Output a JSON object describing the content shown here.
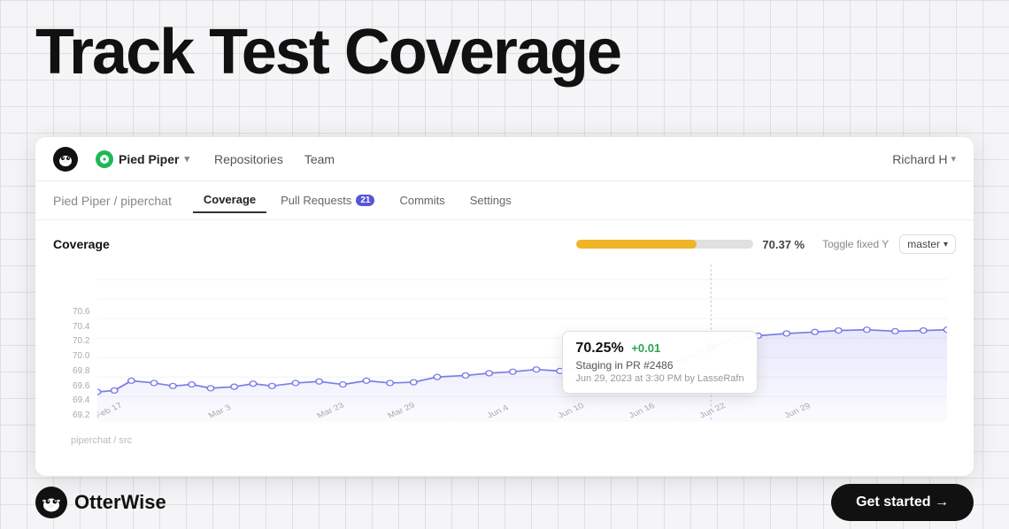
{
  "page": {
    "headline": "Track Test Coverage",
    "background_color": "#f5f5f7"
  },
  "nav": {
    "logo_alt": "OtterWise logo",
    "brand_name": "Pied Piper",
    "brand_chevron": "▾",
    "links": [
      {
        "label": "Repositories",
        "id": "repositories"
      },
      {
        "label": "Team",
        "id": "team"
      }
    ],
    "user": "Richard H",
    "user_chevron": "▾"
  },
  "breadcrumb": {
    "org": "Pied Piper",
    "separator": " / ",
    "repo": "piperchat"
  },
  "tabs": [
    {
      "label": "Coverage",
      "id": "coverage",
      "active": true,
      "badge": null
    },
    {
      "label": "Pull Requests",
      "id": "pull-requests",
      "active": false,
      "badge": "21"
    },
    {
      "label": "Commits",
      "id": "commits",
      "active": false,
      "badge": null
    },
    {
      "label": "Settings",
      "id": "settings",
      "active": false,
      "badge": null
    }
  ],
  "chart": {
    "title": "Coverage",
    "progress_percent": 70.37,
    "progress_label": "70.37 %",
    "progress_fill_width": "68%",
    "toggle_label": "Toggle fixed Y",
    "branch_label": "master",
    "y_labels": [
      "70.6",
      "70.4",
      "70.2",
      "70.0",
      "69.8",
      "69.6",
      "69.4",
      "69.2"
    ],
    "x_labels": [
      "Feb 17",
      "Mar 3",
      "Mar 23",
      "Mar 29",
      "Jun 4",
      "Jun 10",
      "Jun 16",
      "Jun 22",
      "Jun 29"
    ],
    "tooltip": {
      "value": "70.25%",
      "change": "+0.01",
      "description": "Staging in PR #2486",
      "date": "Jun 29, 2023 at 3:30 PM by LasseRafn"
    }
  },
  "footer": {
    "brand_name": "OtterWise",
    "cta_label": "Get started →",
    "breadcrumb_path": "piperchat / src"
  }
}
